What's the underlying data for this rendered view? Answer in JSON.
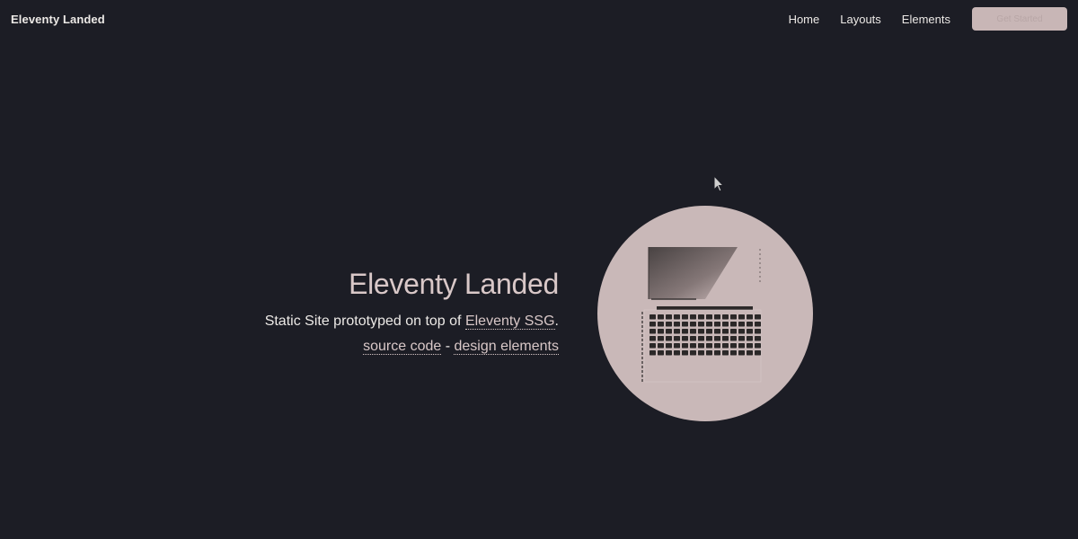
{
  "header": {
    "brand": "Eleventy Landed",
    "nav": {
      "home": "Home",
      "layouts": "Layouts",
      "elements": "Elements",
      "cta_label": "Get Started"
    }
  },
  "hero": {
    "title": "Eleventy Landed",
    "subtitle_prefix": "Static Site prototyped on top of ",
    "subtitle_link": "Eleventy SSG",
    "subtitle_suffix": ".",
    "source_link": "source code",
    "separator": " - ",
    "design_link": "design elements",
    "image_icon": "laptop-icon"
  },
  "colors": {
    "background": "#1c1d25",
    "accent": "#c9b8b8",
    "text": "#ece9e6"
  }
}
